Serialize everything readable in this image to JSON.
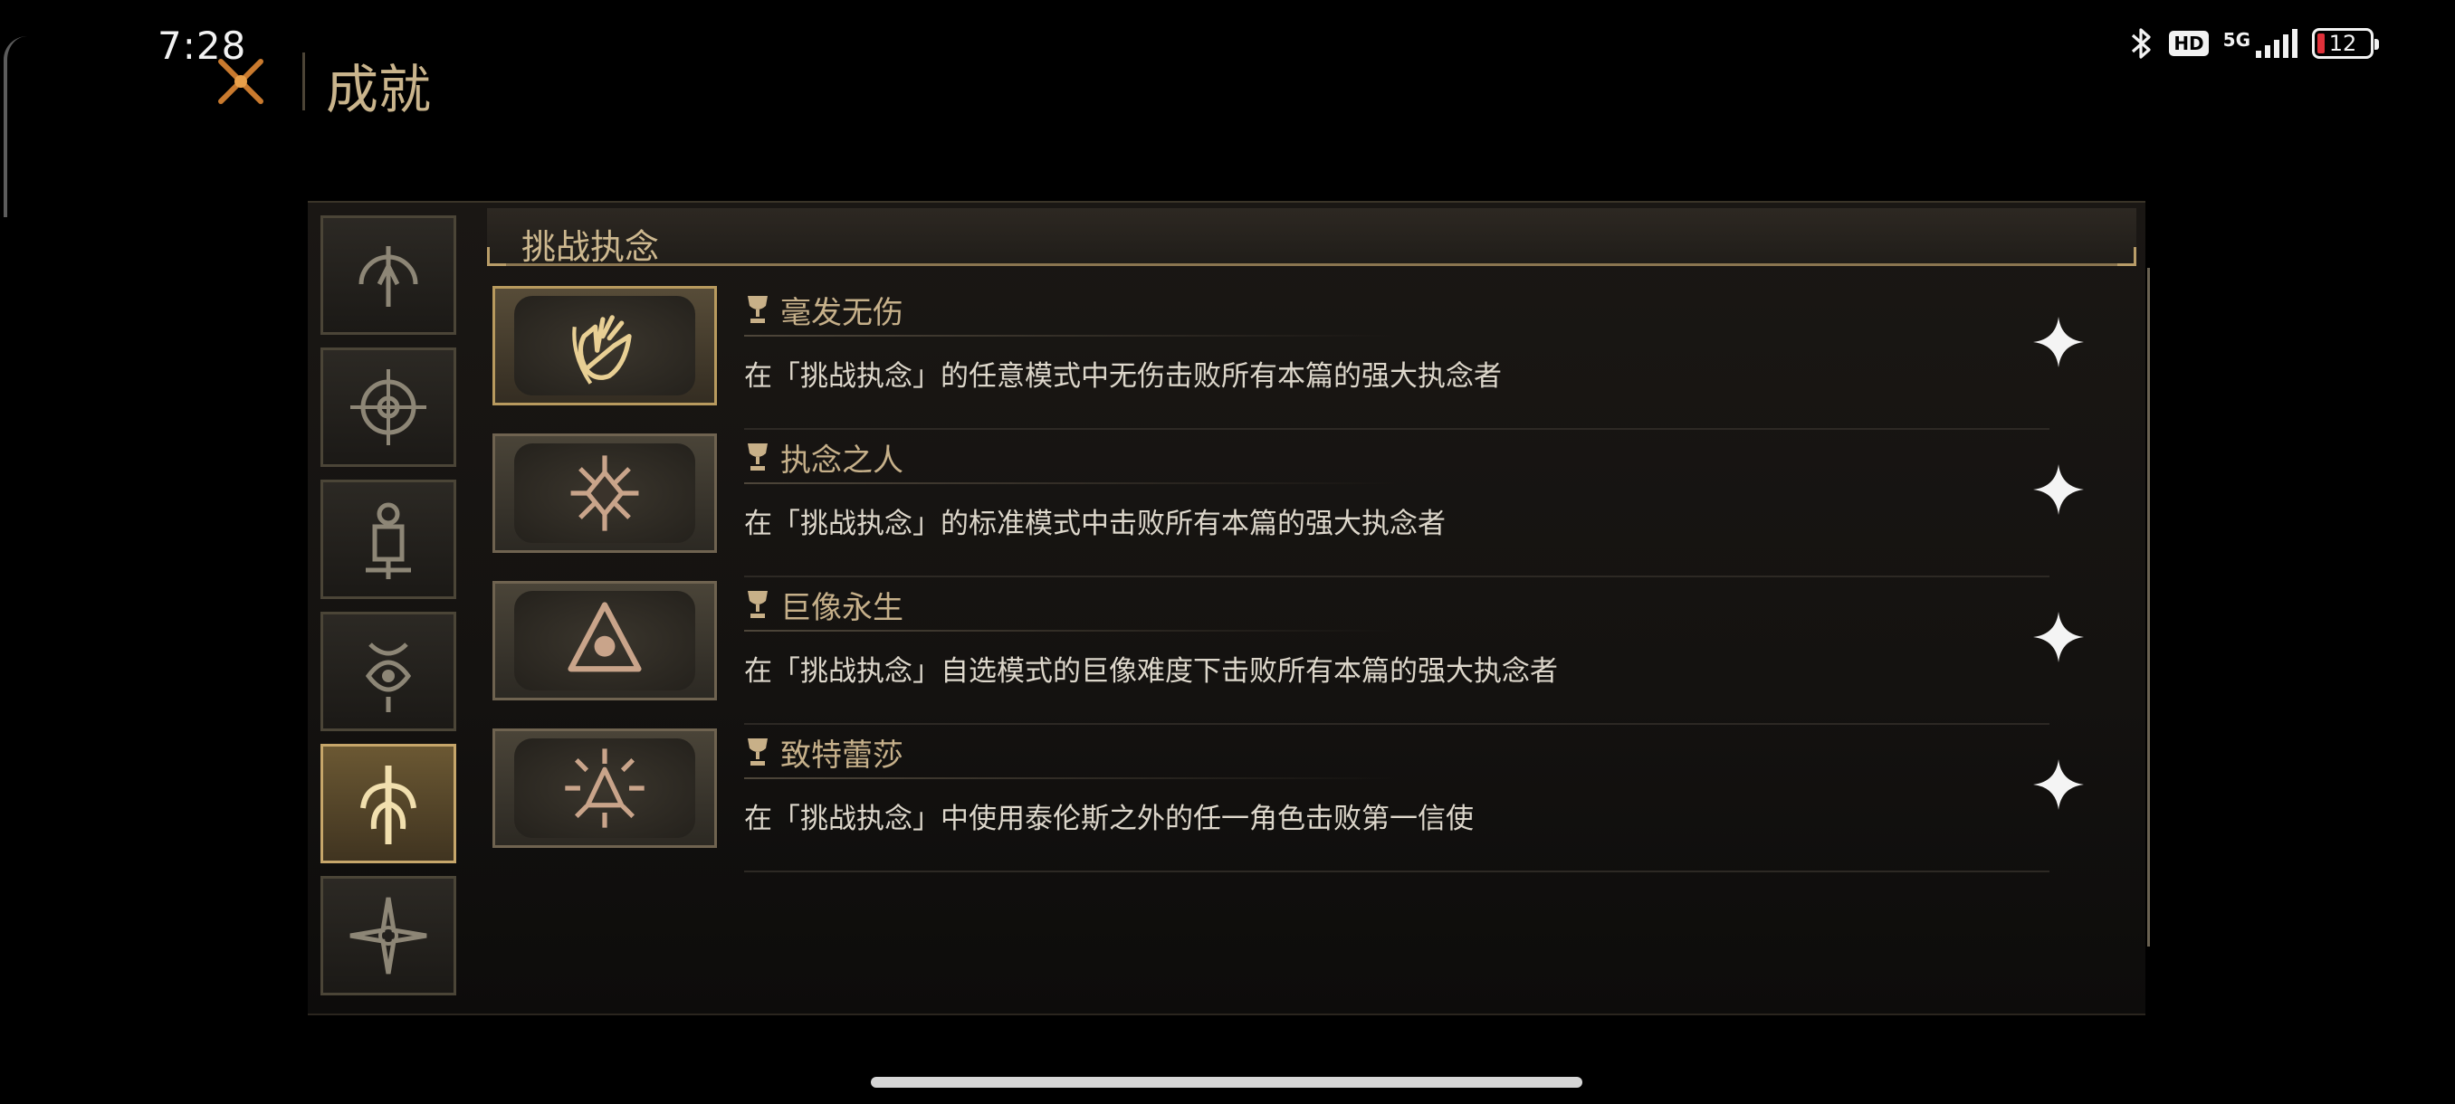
{
  "status_bar": {
    "time": "7:28",
    "hd": "HD",
    "network": "5G",
    "battery": "12"
  },
  "header": {
    "title": "成就",
    "icon": "crossed-swords-icon"
  },
  "categories": [
    {
      "icon": "sigil-arc-icon",
      "active": false
    },
    {
      "icon": "sigil-compass-icon",
      "active": false
    },
    {
      "icon": "sigil-lantern-icon",
      "active": false
    },
    {
      "icon": "sigil-eye-crown-icon",
      "active": false
    },
    {
      "icon": "sigil-tree-icon",
      "active": true
    },
    {
      "icon": "sigil-star-burst-icon",
      "active": false
    }
  ],
  "section": {
    "title": "挑战执念"
  },
  "achievements": [
    {
      "name": "毫发无伤",
      "desc": "在「挑战执念」的任意模式中无伤击败所有本篇的强大执念者",
      "icon": "hand-icon",
      "unlocked": true
    },
    {
      "name": "执念之人",
      "desc": "在「挑战执念」的标准模式中击败所有本篇的强大执念者",
      "icon": "radiant-sigil-icon",
      "unlocked": false
    },
    {
      "name": "巨像永生",
      "desc": "在「挑战执念」自选模式的巨像难度下击败所有本篇的强大执念者",
      "icon": "eye-triangle-icon",
      "unlocked": false
    },
    {
      "name": "致特蕾莎",
      "desc": "在「挑战执念」中使用泰伦斯之外的任一角色击败第一信使",
      "icon": "starburst-triangle-icon",
      "unlocked": false
    }
  ],
  "colors": {
    "accent_gold": "#c6a66a",
    "title_text": "#c9b48c",
    "background": "#000000"
  }
}
